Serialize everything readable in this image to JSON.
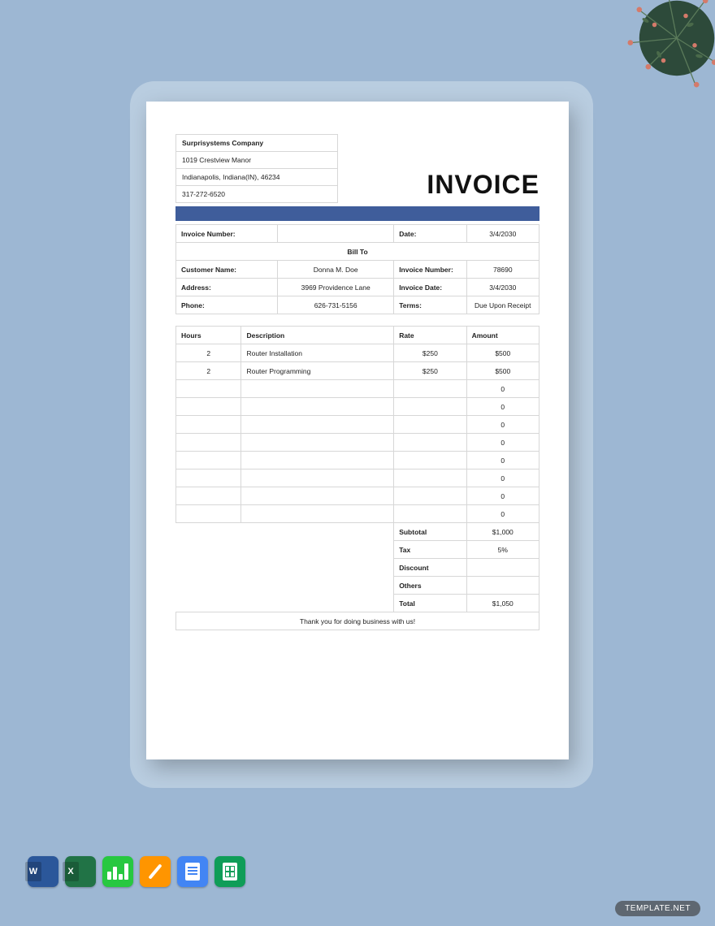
{
  "company": {
    "name": "Surprisystems Company",
    "address1": "1019 Crestview Manor",
    "address2": "Indianapolis, Indiana(IN), 46234",
    "phone": "317-272-6520"
  },
  "title": "INVOICE",
  "header": {
    "invoice_number_label": "Invoice Number:",
    "date_label": "Date:",
    "date_value": "3/4/2030",
    "bill_to": "Bill To"
  },
  "bill": {
    "customer_label": "Customer Name:",
    "customer_value": "Donna M. Doe",
    "inv_num_label": "Invoice Number:",
    "inv_num_value": "78690",
    "address_label": "Address:",
    "address_value": "3969 Providence Lane",
    "inv_date_label": "Invoice Date:",
    "inv_date_value": "3/4/2030",
    "phone_label": "Phone:",
    "phone_value": "626-731-5156",
    "terms_label": "Terms:",
    "terms_value": "Due Upon Receipt"
  },
  "columns": {
    "hours": "Hours",
    "description": "Description",
    "rate": "Rate",
    "amount": "Amount"
  },
  "items": [
    {
      "hours": "2",
      "description": "Router Installation",
      "rate": "$250",
      "amount": "$500"
    },
    {
      "hours": "2",
      "description": "Router Programming",
      "rate": "$250",
      "amount": "$500"
    },
    {
      "hours": "",
      "description": "",
      "rate": "",
      "amount": "0"
    },
    {
      "hours": "",
      "description": "",
      "rate": "",
      "amount": "0"
    },
    {
      "hours": "",
      "description": "",
      "rate": "",
      "amount": "0"
    },
    {
      "hours": "",
      "description": "",
      "rate": "",
      "amount": "0"
    },
    {
      "hours": "",
      "description": "",
      "rate": "",
      "amount": "0"
    },
    {
      "hours": "",
      "description": "",
      "rate": "",
      "amount": "0"
    },
    {
      "hours": "",
      "description": "",
      "rate": "",
      "amount": "0"
    },
    {
      "hours": "",
      "description": "",
      "rate": "",
      "amount": "0"
    }
  ],
  "summary": {
    "subtotal_label": "Subtotal",
    "subtotal_value": "$1,000",
    "tax_label": "Tax",
    "tax_value": "5%",
    "discount_label": "Discount",
    "discount_value": "",
    "others_label": "Others",
    "others_value": "",
    "total_label": "Total",
    "total_value": "$1,050"
  },
  "footer_note": "Thank you for doing business with us!",
  "format_labels": {
    "word": "W",
    "excel": "X"
  },
  "watermark": "TEMPLATE.NET"
}
